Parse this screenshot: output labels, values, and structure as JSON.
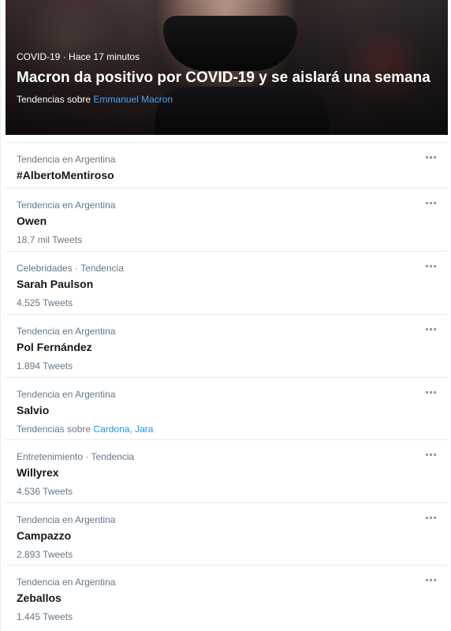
{
  "hero": {
    "category": "COVID-19",
    "separator": "·",
    "time": "Hace 17 minutos",
    "title": "Macron da positivo por COVID-19 y se aislará una semana",
    "related_prefix": "Tendencias sobre",
    "related_link": "Emmanuel Macron"
  },
  "trends": [
    {
      "context": "Tendencia en Argentina",
      "name": "#AlbertoMentiroso",
      "count": "",
      "related_prefix": "",
      "related_links": ""
    },
    {
      "context": "Tendencia en Argentina",
      "name": "Owen",
      "count": "18,7 mil Tweets",
      "related_prefix": "",
      "related_links": ""
    },
    {
      "context": "Celebridades · Tendencia",
      "name": "Sarah Paulson",
      "count": "4.525 Tweets",
      "related_prefix": "",
      "related_links": ""
    },
    {
      "context": "Tendencia en Argentina",
      "name": "Pol Fernández",
      "count": "1.894 Tweets",
      "related_prefix": "",
      "related_links": ""
    },
    {
      "context": "Tendencia en Argentina",
      "name": "Salvio",
      "count": "",
      "related_prefix": "Tendencias sobre",
      "related_links": "Cardona, Jara"
    },
    {
      "context": "Entretenimiento · Tendencia",
      "name": "Willyrex",
      "count": "4.536 Tweets",
      "related_prefix": "",
      "related_links": ""
    },
    {
      "context": "Tendencia en Argentina",
      "name": "Campazzo",
      "count": "2.893 Tweets",
      "related_prefix": "",
      "related_links": ""
    },
    {
      "context": "Tendencia en Argentina",
      "name": "Zeballos",
      "count": "1.445 Tweets",
      "related_prefix": "",
      "related_links": ""
    }
  ],
  "icons": {
    "more": "more-horizontal-icon"
  },
  "colors": {
    "link": "#1b95e0",
    "secondary_text": "#657786",
    "divider": "#e6ecf0"
  }
}
